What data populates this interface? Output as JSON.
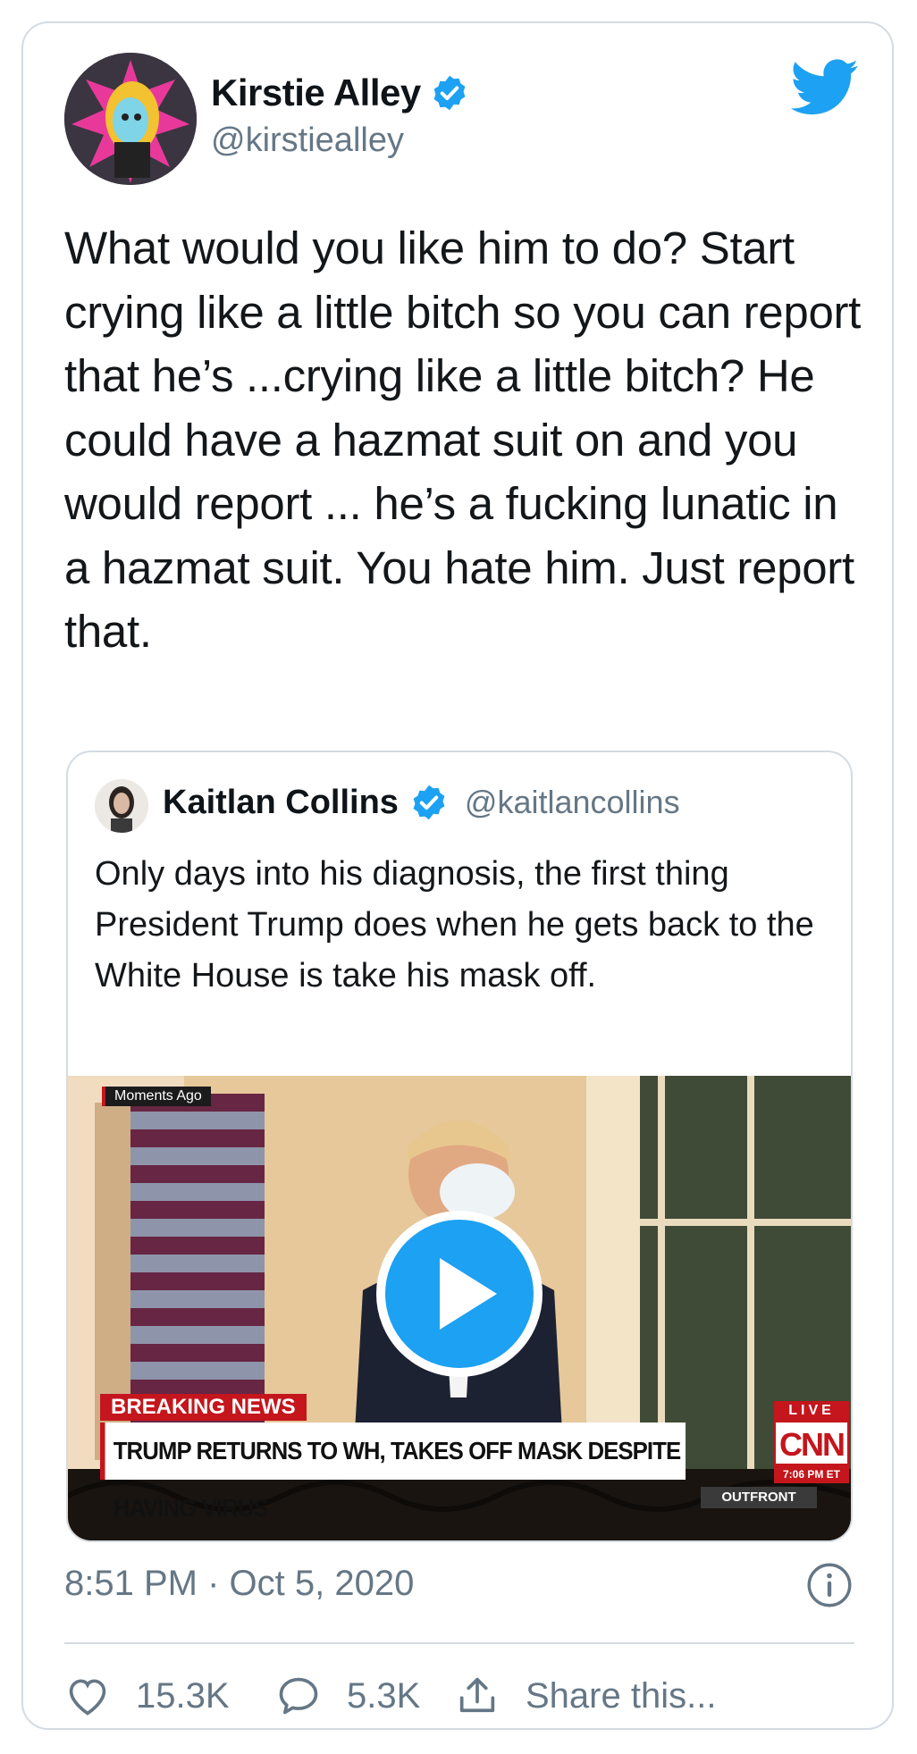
{
  "tweet": {
    "display_name": "Kirstie Alley",
    "handle": "@kirstiealley",
    "text": "What would you like him to do? Start crying like a little bitch so you can report that he’s ...crying like a little bitch? He could have a hazmat suit on and you would report ... he’s a fucking lunatic in a hazmat suit. You hate him. Just report that.",
    "timestamp": "8:51 PM · Oct 5, 2020",
    "likes": "15.3K",
    "replies": "5.3K",
    "share_label": "Share this..."
  },
  "quoted_tweet": {
    "display_name": "Kaitlan Collins",
    "handle": "@kaitlancollins",
    "text": "Only days into his diagnosis, the first thing President Trump does when he gets back to the White House is take his mask off.",
    "video": {
      "moments_label": "Moments Ago",
      "breaking_label": "BREAKING NEWS",
      "headline": "TRUMP RETURNS TO WH, TAKES OFF MASK DESPITE HAVING VIRUS",
      "live_label": "LIVE",
      "network": "CNN",
      "time": "7:06 PM ET",
      "show": "OUTFRONT"
    }
  },
  "colors": {
    "twitter_blue": "#1da1f2",
    "text_primary": "#14171a",
    "text_secondary": "#657786",
    "border": "#d4dbe1",
    "cnn_red": "#c4161c"
  },
  "icons": {
    "brand": "twitter-bird-icon",
    "verified": "verified-badge-icon",
    "like": "heart-icon",
    "reply": "speech-bubble-icon",
    "share": "share-upload-icon",
    "info": "info-icon",
    "play": "play-icon"
  }
}
